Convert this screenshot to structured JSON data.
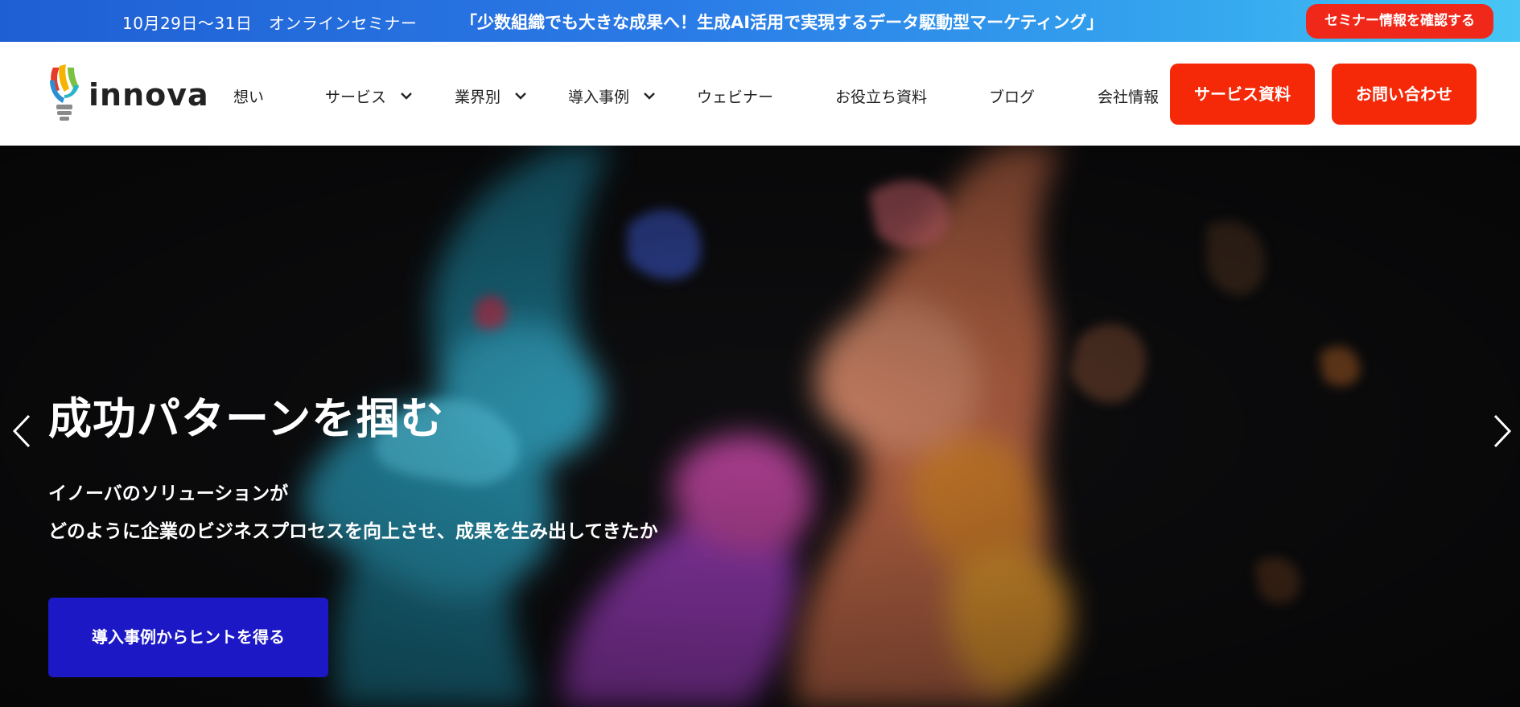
{
  "announcement": {
    "date": "10月29日～31日　オンラインセミナー",
    "title": "「少数組織でも大きな成果へ！生成AI活用で実現するデータ駆動型マーケティング」",
    "button_label": "セミナー情報を確認する"
  },
  "header": {
    "logo_text": "innova",
    "nav": [
      {
        "label": "想い",
        "has_dropdown": false
      },
      {
        "label": "サービス",
        "has_dropdown": true
      },
      {
        "label": "業界別",
        "has_dropdown": true
      },
      {
        "label": "導入事例",
        "has_dropdown": true
      },
      {
        "label": "ウェビナー",
        "has_dropdown": false
      },
      {
        "label": "お役立ち資料",
        "has_dropdown": false
      },
      {
        "label": "ブログ",
        "has_dropdown": false
      },
      {
        "label": "会社情報",
        "has_dropdown": false
      }
    ],
    "service_doc_label": "サービス資料",
    "contact_label": "お問い合わせ"
  },
  "hero": {
    "headline": "成功パターンを掴む",
    "sub_line_1": "イノーバのソリューションが",
    "sub_line_2": "どのように企業のビジネスプロセスを向上させ、成果を生み出してきたか",
    "cta_label": "導入事例からヒントを得る",
    "prev_icon": "chevron-left-icon",
    "next_icon": "chevron-right-icon"
  },
  "colors": {
    "brand_red": "#f52808",
    "cta_blue": "#1c18c6",
    "announce_gradient_start": "#1f5fd4",
    "announce_gradient_end": "#47c6f4",
    "hero_bg": "#0e0e10"
  }
}
